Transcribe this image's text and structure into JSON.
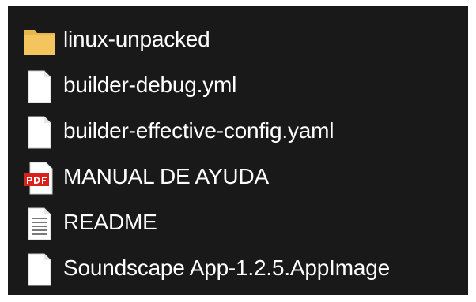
{
  "files": [
    {
      "name": "linux-unpacked",
      "icon": "folder-icon",
      "color": "#f4c55f"
    },
    {
      "name": "builder-debug.yml",
      "icon": "blank-file-icon",
      "color": "#ffffff"
    },
    {
      "name": "builder-effective-config.yaml",
      "icon": "blank-file-icon",
      "color": "#ffffff"
    },
    {
      "name": "MANUAL DE AYUDA",
      "icon": "pdf-file-icon",
      "color": "#d9221c"
    },
    {
      "name": "README",
      "icon": "text-file-icon",
      "color": "#ffffff"
    },
    {
      "name": "Soundscape App-1.2.5.AppImage",
      "icon": "blank-file-icon",
      "color": "#ffffff"
    }
  ]
}
